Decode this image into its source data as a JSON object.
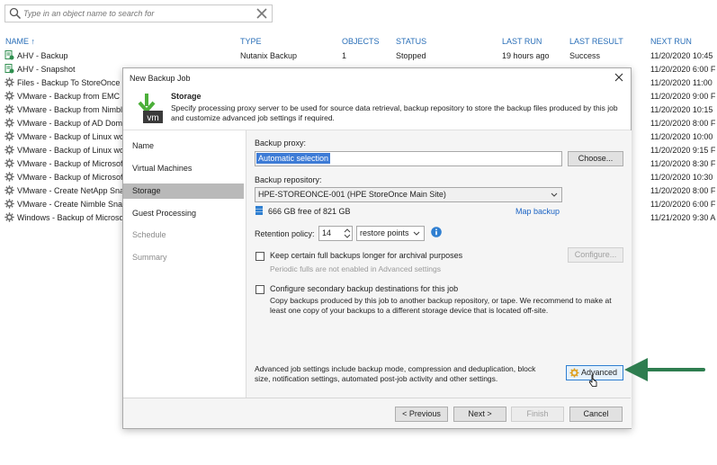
{
  "search": {
    "placeholder": "Type in an object name to search for"
  },
  "table": {
    "headers": {
      "name": "NAME ↑",
      "type": "TYPE",
      "objects": "OBJECTS",
      "status": "STATUS",
      "last_run": "LAST RUN",
      "last_result": "LAST RESULT",
      "next_run": "NEXT RUN"
    },
    "rows": [
      {
        "name": "AHV - Backup",
        "type": "Nutanix Backup",
        "objects": "1",
        "status": "Stopped",
        "last_run": "19 hours ago",
        "last_result": "Success",
        "next_run": "11/20/2020 10:45",
        "icon": "nutanix-job-icon"
      },
      {
        "name": "AHV - Snapshot",
        "type": "",
        "objects": "",
        "status": "",
        "last_run": "",
        "last_result": "",
        "next_run": "11/20/2020 6:00 F",
        "icon": "nutanix-job-icon"
      },
      {
        "name": "Files - Backup To StoreOnce",
        "type": "",
        "objects": "",
        "status": "",
        "last_run": "",
        "last_result": "",
        "next_run": "11/20/2020 11:00",
        "icon": "gear-icon"
      },
      {
        "name": "VMware - Backup from EMC U",
        "type": "",
        "objects": "",
        "status": "",
        "last_run": "",
        "last_result": "",
        "next_run": "11/20/2020 9:00 F",
        "icon": "gear-icon"
      },
      {
        "name": "VMware - Backup from Nimbl",
        "type": "",
        "objects": "",
        "status": "",
        "last_run": "",
        "last_result": "",
        "next_run": "11/20/2020 10:15",
        "icon": "gear-icon"
      },
      {
        "name": "VMware - Backup of AD Doma",
        "type": "",
        "objects": "",
        "status": "",
        "last_run": "",
        "last_result": "",
        "next_run": "11/20/2020 8:00 F",
        "icon": "gear-icon"
      },
      {
        "name": "VMware - Backup of Linux wo",
        "type": "",
        "objects": "",
        "status": "",
        "last_run": "",
        "last_result": "",
        "next_run": "11/20/2020 10:00",
        "icon": "gear-icon"
      },
      {
        "name": "VMware - Backup of Linux wo",
        "type": "",
        "objects": "",
        "status": "",
        "last_run": "",
        "last_result": "",
        "next_run": "11/20/2020 9:15 F",
        "icon": "gear-icon"
      },
      {
        "name": "VMware - Backup of Microsof",
        "type": "",
        "objects": "",
        "status": "",
        "last_run": "",
        "last_result": "",
        "next_run": "11/20/2020 8:30 F",
        "icon": "gear-icon"
      },
      {
        "name": "VMware - Backup of Microsof",
        "type": "",
        "objects": "",
        "status": "",
        "last_run": "",
        "last_result": "",
        "next_run": "11/20/2020 10:30",
        "icon": "gear-icon"
      },
      {
        "name": "VMware - Create NetApp Snap",
        "type": "",
        "objects": "",
        "status": "",
        "last_run": "",
        "last_result": "",
        "next_run": "11/20/2020 8:00 F",
        "icon": "gear-icon"
      },
      {
        "name": "VMware - Create Nimble Snap",
        "type": "",
        "objects": "",
        "status": "",
        "last_run": "",
        "last_result": "",
        "next_run": "11/20/2020 6:00 F",
        "icon": "gear-icon"
      },
      {
        "name": "Windows - Backup of Microso",
        "type": "",
        "objects": "",
        "status": "",
        "last_run": "",
        "last_result": "",
        "next_run": "11/21/2020 9:30 A",
        "icon": "gear-icon"
      }
    ]
  },
  "dialog": {
    "title": "New Backup Job",
    "header": {
      "title": "Storage",
      "description": "Specify processing proxy server to be used for source data retrieval, backup repository to store the backup files produced by this job and customize advanced job settings if required.",
      "logo_text": "vm"
    },
    "nav": [
      {
        "label": "Name",
        "state": "normal"
      },
      {
        "label": "Virtual Machines",
        "state": "normal"
      },
      {
        "label": "Storage",
        "state": "active"
      },
      {
        "label": "Guest Processing",
        "state": "normal"
      },
      {
        "label": "Schedule",
        "state": "dim"
      },
      {
        "label": "Summary",
        "state": "dim"
      }
    ],
    "proxy": {
      "label": "Backup proxy:",
      "value": "Automatic selection",
      "choose_label": "Choose..."
    },
    "repository": {
      "label": "Backup repository:",
      "value": "HPE-STOREONCE-001 (HPE StoreOnce Main Site)",
      "free_text": "666 GB free of 821 GB",
      "map_label": "Map backup"
    },
    "retention": {
      "label": "Retention policy:",
      "value": "14",
      "unit": "restore points"
    },
    "archival": {
      "label": "Keep certain full backups longer for archival purposes",
      "note": "Periodic fulls are not enabled in Advanced settings",
      "configure_label": "Configure..."
    },
    "secondary": {
      "label": "Configure secondary backup destinations for this job",
      "note": "Copy backups produced by this job to another backup repository, or tape. We recommend to make at least one copy of your backups to a different storage device that is located off-site."
    },
    "advanced": {
      "text": "Advanced job settings include backup mode, compression and deduplication, block size, notification settings, automated post-job activity and other settings.",
      "button_label": "Advanced"
    },
    "footer": {
      "previous": "< Previous",
      "next": "Next >",
      "finish": "Finish",
      "cancel": "Cancel"
    }
  },
  "colors": {
    "accent_link": "#1a63c4",
    "header_text": "#2a6fb8",
    "arrow": "#2e7d4f",
    "selection": "#3d7bd6"
  }
}
